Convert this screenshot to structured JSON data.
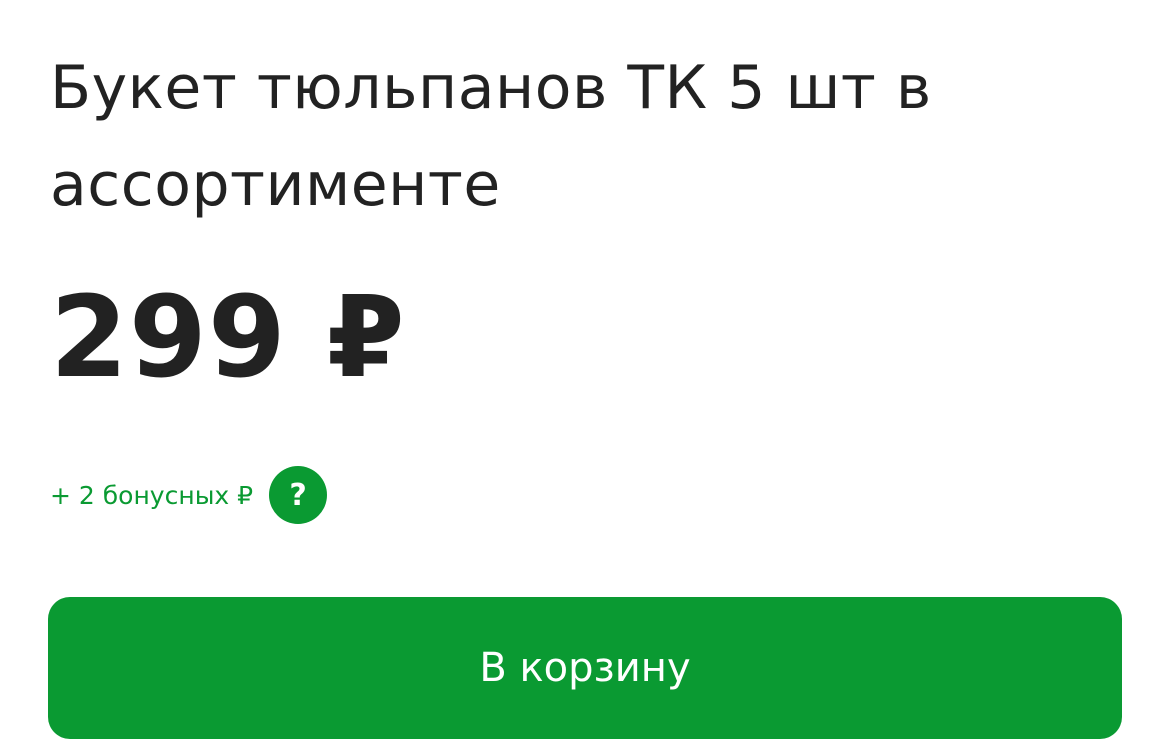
{
  "product": {
    "title": "Букет тюльпанов ТК 5 шт в ассортименте",
    "price": "299 ₽",
    "bonus_text": "+ 2 бонусных ₽",
    "help_label": "?",
    "add_to_cart_label": "В корзину"
  },
  "colors": {
    "accent": "#0a9a32",
    "text": "#222222",
    "background": "#ffffff"
  },
  "icons": {
    "help": "question-mark-icon"
  }
}
